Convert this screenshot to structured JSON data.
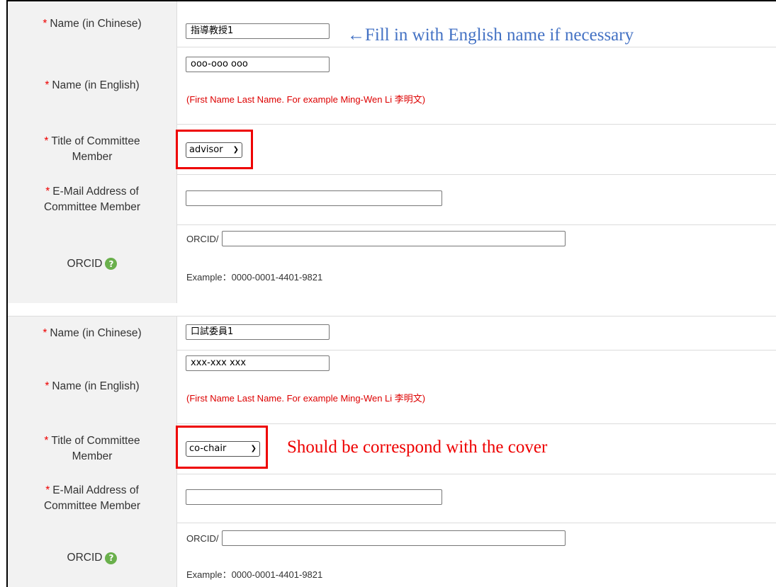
{
  "annotations": {
    "name_hint": "←Fill in with English name if necessary",
    "title_hint": "Should be correspond with the cover"
  },
  "labels": {
    "required_mark": "*",
    "name_chinese": "Name (in Chinese)",
    "name_english": "Name (in English)",
    "title_line1": "Title of Committee",
    "title_line2": "Member",
    "email_line1": "E-Mail Address of",
    "email_line2": "Committee Member",
    "orcid": "ORCID",
    "orcid_prefix": "ORCID/"
  },
  "help_icon": "question-circle-icon",
  "members": [
    {
      "name_chinese": "指導教授1",
      "name_english": "ooo-ooo ooo",
      "english_hint": "(First Name Last Name. For example Ming-Wen Li 李明文)",
      "title": "advisor",
      "email": "",
      "orcid": "",
      "orcid_example": "Example：0000-0001-4401-9821"
    },
    {
      "name_chinese": "口試委員1",
      "name_english": "xxx-xxx xxx",
      "english_hint": "(First Name Last Name. For example Ming-Wen Li 李明文)",
      "title": "co-chair",
      "email": "",
      "orcid": "",
      "orcid_example": "Example：0000-0001-4401-9821"
    }
  ],
  "colors": {
    "highlight": "#e00000",
    "annotation_blue": "#4472c4",
    "required": "#e00000"
  }
}
